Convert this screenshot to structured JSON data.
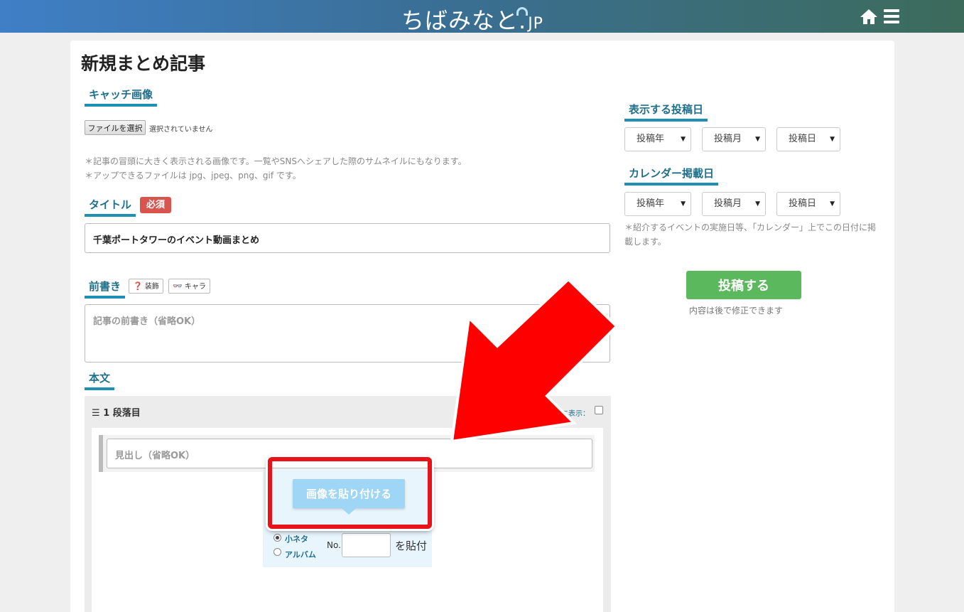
{
  "header": {
    "logo_text": "ちばみなと.",
    "logo_suffix": "JP"
  },
  "page": {
    "title": "新規まとめ記事"
  },
  "catch_image": {
    "section_label": "キャッチ画像",
    "file_button": "ファイルを選択",
    "file_status": "選択されていません",
    "note_line1": "＊記事の冒頭に大きく表示される画像です。一覧やSNSへシェアした際のサムネイルにもなります。",
    "note_line2": "＊アップできるファイルは jpg、jpeg、png、gif です。"
  },
  "title_field": {
    "section_label": "タイトル",
    "required_badge": "必須",
    "value": "千葉ポートタワーのイベント動画まとめ"
  },
  "preface": {
    "section_label": "前書き",
    "btn_decoration": "装飾",
    "btn_character": "キャラ",
    "placeholder": "記事の前書き（省略OK）"
  },
  "body": {
    "section_label": "本文",
    "paragraph_title": "1 段落目",
    "toc_label": "目次に表示：",
    "heading_placeholder": "見出し（省略OK）",
    "paste_button": "画像を貼り付ける",
    "radio_small": "小ネタ",
    "radio_album": "アルバム",
    "no_label": "No.",
    "paste_suffix": "を貼付"
  },
  "sidebar": {
    "post_date_label": "表示する投稿日",
    "calendar_date_label": "カレンダー掲載日",
    "select_year": "投稿年",
    "select_month": "投稿月",
    "select_day": "投稿日",
    "calendar_note": "＊紹介するイベントの実施日等、「カレンダー」上でこの日付に掲載します。",
    "submit_label": "投稿する",
    "submit_note": "内容は後で修正できます"
  },
  "colors": {
    "accent": "#1e90b4",
    "required": "#d9534f",
    "submit": "#5cb85c",
    "annotation_red": "#e8121a"
  }
}
